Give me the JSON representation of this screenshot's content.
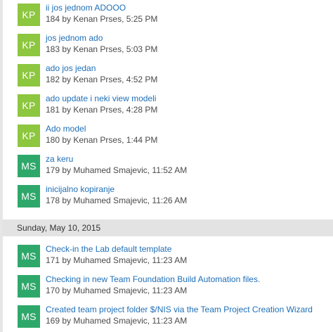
{
  "colors": {
    "kp_avatar": "#8dc63f",
    "ms_avatar": "#2ea86a",
    "link": "#1e6fb7",
    "meta_text": "#4a4a4a",
    "date_header_bg": "#e3e3e3"
  },
  "group1": {
    "commits": [
      {
        "initials": "KP",
        "title": "ii jos jednom ADOOO",
        "meta": "184 by Kenan Prses, 5:25 PM"
      },
      {
        "initials": "KP",
        "title": "jos jednom ado",
        "meta": "183 by Kenan Prses, 5:03 PM"
      },
      {
        "initials": "KP",
        "title": "ado jos jedan",
        "meta": "182 by Kenan Prses, 4:52 PM"
      },
      {
        "initials": "KP",
        "title": "ado update i neki view modeli",
        "meta": "181 by Kenan Prses, 4:28 PM"
      },
      {
        "initials": "KP",
        "title": "Ado model",
        "meta": "180 by Kenan Prses, 1:44 PM"
      },
      {
        "initials": "MS",
        "title": "za keru",
        "meta": "179 by Muhamed Smajevic, 11:52 AM"
      },
      {
        "initials": "MS",
        "title": "inicijalno kopiranje",
        "meta": "178 by Muhamed Smajevic, 11:26 AM"
      }
    ]
  },
  "date_header": {
    "label": "Sunday, May 10, 2015"
  },
  "group2": {
    "commits": [
      {
        "initials": "MS",
        "title": "Check-in the Lab default template",
        "meta": "171 by Muhamed Smajevic, 11:23 AM"
      },
      {
        "initials": "MS",
        "title": "Checking in new Team Foundation Build Automation files.",
        "meta": "170 by Muhamed Smajevic, 11:23 AM"
      },
      {
        "initials": "MS",
        "title": "Created team project folder $/NIS via the Team Project Creation Wizard",
        "meta": "169 by Muhamed Smajevic, 11:23 AM"
      }
    ]
  }
}
